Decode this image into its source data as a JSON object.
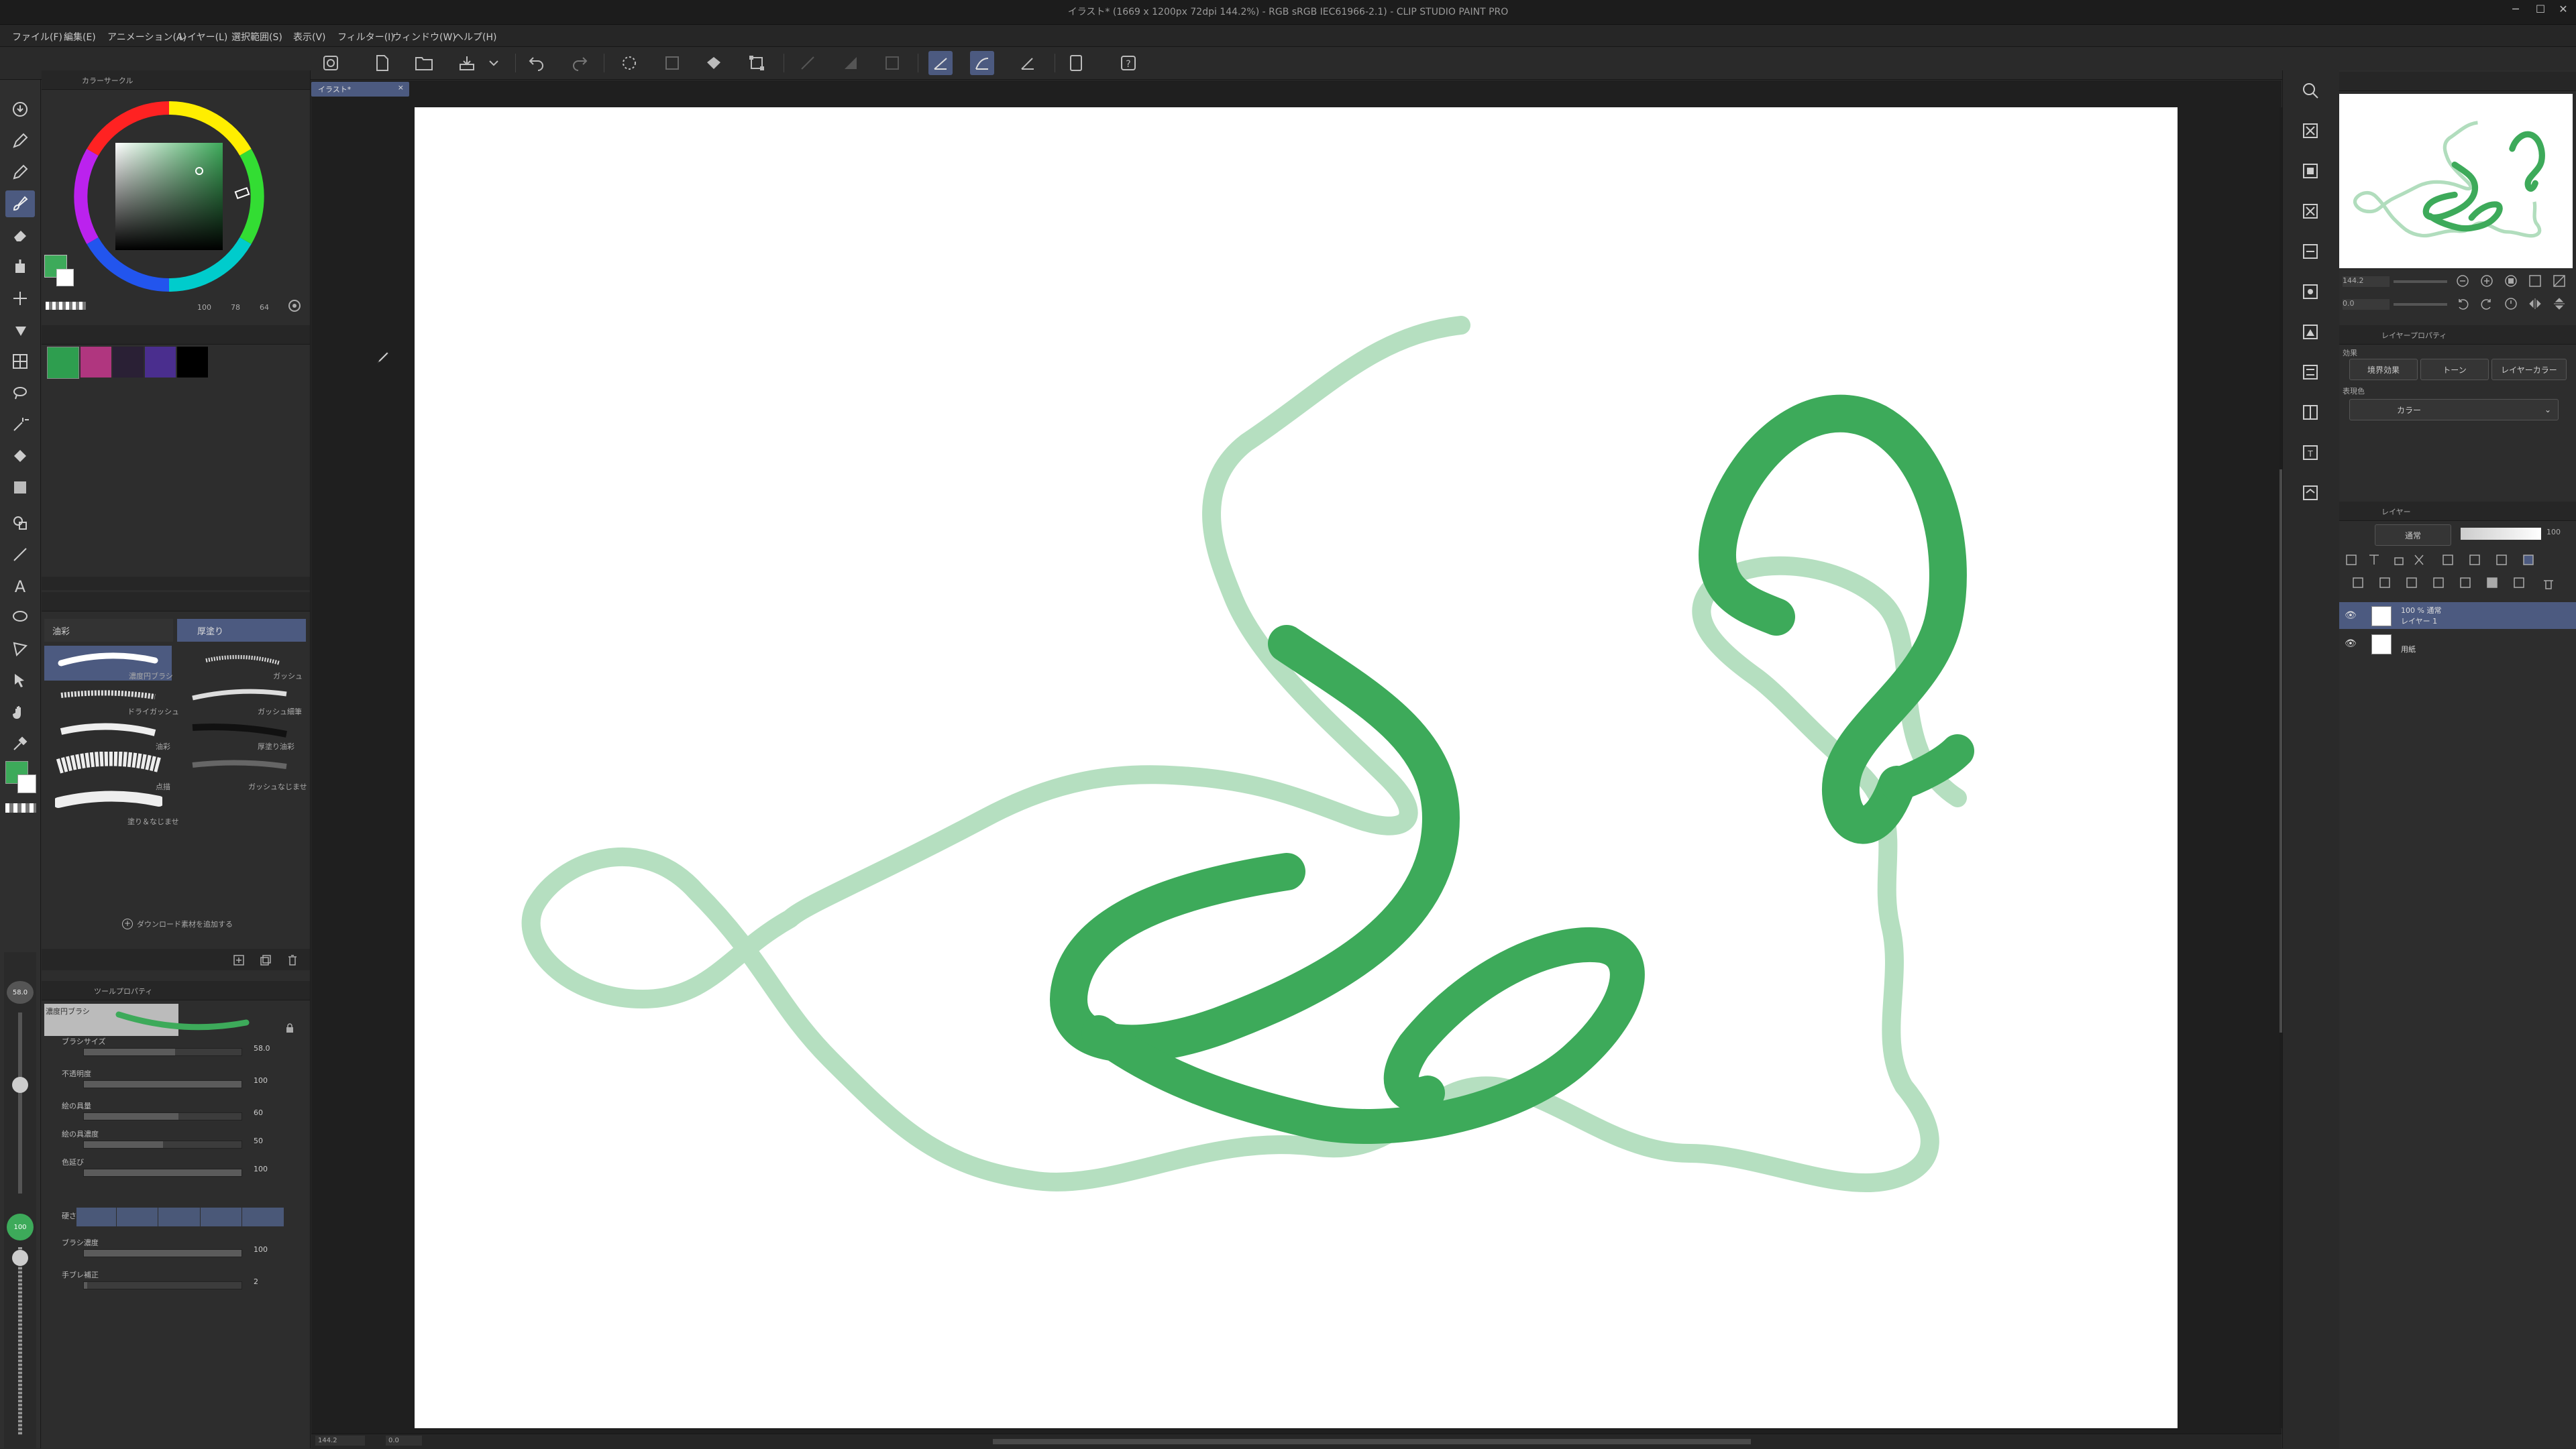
{
  "window": {
    "title": "イラスト* (1669 x 1200px 72dpi 144.2%) - RGB sRGB IEC61966-2.1) - CLIP STUDIO PAINT PRO"
  },
  "menu": [
    "ファイル(F)",
    "編集(E)",
    "アニメーション(A)",
    "レイヤー(L)",
    "選択範囲(S)",
    "表示(V)",
    "フィルター(I)",
    "ウィンドウ(W)",
    "ヘルプ(H)"
  ],
  "canvas_tab": {
    "label": "イラスト*"
  },
  "color_panel": {
    "tab": "カラーサークル",
    "hex_primary": "#3daa5a",
    "values": [
      "100",
      "78",
      "64"
    ]
  },
  "swatches": [
    "#2e9e4f",
    "#b0367f",
    "#2a2035",
    "#4a2e8e",
    "#000000"
  ],
  "subtool": {
    "tabs": [
      "油彩",
      "厚塗り"
    ],
    "brushes": [
      {
        "left": "濃度円ブラシ",
        "right": "ガッシュ"
      },
      {
        "left": "ドライガッシュ",
        "right": "ガッシュ細筆"
      },
      {
        "left": "油彩",
        "right": "厚塗り油彩"
      },
      {
        "left": "点描",
        "right": "ガッシュなじませ"
      },
      {
        "left": "塗り＆なじませ",
        "right": ""
      }
    ],
    "add_link": "ダウンロード素材を追加する"
  },
  "tool_property": {
    "tab_label": "ツールプロパティ",
    "brush_name": "濃度円ブラシ",
    "rows": [
      {
        "label": "ブラシサイズ",
        "value": "58.0"
      },
      {
        "label": "不透明度",
        "value": "100"
      },
      {
        "label": "絵の具量",
        "value": "60"
      },
      {
        "label": "絵の具濃度",
        "value": "50"
      },
      {
        "label": "色延び",
        "value": "100"
      },
      {
        "label": "硬さ",
        "value": ""
      },
      {
        "label": "ブラシ濃度",
        "value": "100"
      },
      {
        "label": "手ブレ補正",
        "value": "2"
      }
    ],
    "size_indicator": "58.0",
    "opacity_indicator": "100"
  },
  "navigator": {
    "zoom": "144.2",
    "rotate": "0.0"
  },
  "layer_property": {
    "tab_label": "レイヤープロパティ",
    "effect_label": "効果",
    "buttons": [
      "境界効果",
      "トーン",
      "レイヤーカラー"
    ],
    "expression_label": "表現色",
    "expression_value": "カラー"
  },
  "layer_panel": {
    "tab_label": "レイヤー",
    "blend": "通常",
    "opacity": "100",
    "layers": [
      {
        "title": "100 % 通常",
        "name": "レイヤー 1",
        "selected": true
      },
      {
        "title": "",
        "name": "用紙",
        "selected": false
      }
    ]
  },
  "statusbar": {
    "zoom": "144.2",
    "angle": "0.0"
  },
  "brush_color": "#3daa5a"
}
